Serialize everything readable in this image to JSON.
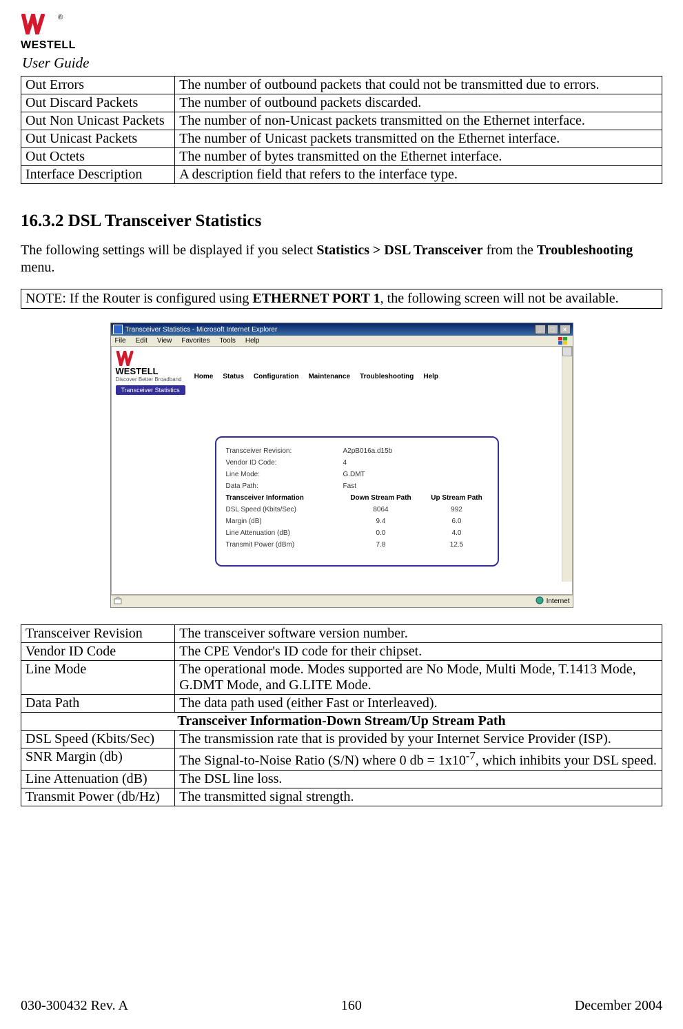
{
  "header": {
    "logo_word": "WESTELL",
    "section_label": "User Guide"
  },
  "table1": {
    "rows": [
      {
        "name": "Out Errors",
        "desc": "The number of outbound packets that could not be transmitted due to errors."
      },
      {
        "name": "Out Discard Packets",
        "desc": "The number of outbound packets discarded."
      },
      {
        "name": "Out Non Unicast Packets",
        "desc": "The number of non-Unicast packets transmitted on the Ethernet interface."
      },
      {
        "name": "Out Unicast Packets",
        "desc": "The number of Unicast packets transmitted on the Ethernet interface."
      },
      {
        "name": "Out Octets",
        "desc": "The number of bytes transmitted on the Ethernet interface."
      },
      {
        "name": "Interface Description",
        "desc": "A description field that refers to the interface type."
      }
    ]
  },
  "section": {
    "number": "16.3.2",
    "title": "DSL Transceiver Statistics",
    "intro_pre": "The following settings will be displayed if you select ",
    "intro_bold1": "Statistics > DSL Transceiver",
    "intro_mid": " from the ",
    "intro_bold2": "Troubleshooting",
    "intro_post": " menu."
  },
  "note": {
    "pre": "NOTE: If the Router is configured using ",
    "bold": "ETHERNET PORT 1",
    "post": ", the following screen will not be available."
  },
  "screenshot": {
    "window_title": "Transceiver Statistics - Microsoft Internet Explorer",
    "menu": {
      "file": "File",
      "edit": "Edit",
      "view": "View",
      "favorites": "Favorites",
      "tools": "Tools",
      "help": "Help"
    },
    "brand_word": "WESTELL",
    "brand_tag": "Discover Better Broadband",
    "nav": {
      "home": "Home",
      "status": "Status",
      "config": "Configuration",
      "maint": "Maintenance",
      "trouble": "Troubleshooting",
      "help": "Help"
    },
    "submenu": "Transceiver Statistics",
    "card": {
      "rev_label": "Transceiver Revision:",
      "rev_val": "A2pB016a.d15b",
      "vendor_label": "Vendor ID Code:",
      "vendor_val": "4",
      "mode_label": "Line Mode:",
      "mode_val": "G.DMT",
      "path_label": "Data Path:",
      "path_val": "Fast",
      "info_hdr": "Transceiver Information",
      "down_hdr": "Down Stream Path",
      "up_hdr": "Up Stream Path",
      "rows": [
        {
          "n": "DSL Speed (Kbits/Sec)",
          "d": "8064",
          "u": "992"
        },
        {
          "n": "Margin (dB)",
          "d": "9.4",
          "u": "6.0"
        },
        {
          "n": "Line Attenuation (dB)",
          "d": "0.0",
          "u": "4.0"
        },
        {
          "n": "Transmit Power (dBm)",
          "d": "7.8",
          "u": "12.5"
        }
      ]
    },
    "status_zone": "Internet"
  },
  "table2": {
    "rows_a": [
      {
        "name": "Transceiver Revision",
        "desc": "The transceiver software version number."
      },
      {
        "name": "Vendor ID Code",
        "desc": "The CPE Vendor's ID code for their chipset."
      },
      {
        "name": "Line Mode",
        "desc": "The operational mode. Modes supported are No Mode, Multi Mode, T.1413 Mode, G.DMT Mode, and G.LITE Mode."
      },
      {
        "name": "Data Path",
        "desc": "The data path used (either Fast or Interleaved)."
      }
    ],
    "sub_hdr": "Transceiver Information-Down Stream/Up Stream Path",
    "rows_b": [
      {
        "name": "DSL Speed (Kbits/Sec)",
        "desc": "The transmission rate that is provided by your Internet Service Provider (ISP)."
      },
      {
        "name": "SNR Margin (db)",
        "desc_pre": "The Signal-to-Noise Ratio (S/N) where 0 db = 1x10",
        "desc_sup": "-7",
        "desc_post": ", which inhibits your DSL speed."
      },
      {
        "name": "Line Attenuation (dB)",
        "desc": "The DSL line loss."
      },
      {
        "name": "Transmit Power (db/Hz)",
        "desc": "The transmitted signal strength."
      }
    ]
  },
  "footer": {
    "left": "030-300432 Rev. A",
    "center": "160",
    "right": "December 2004"
  }
}
